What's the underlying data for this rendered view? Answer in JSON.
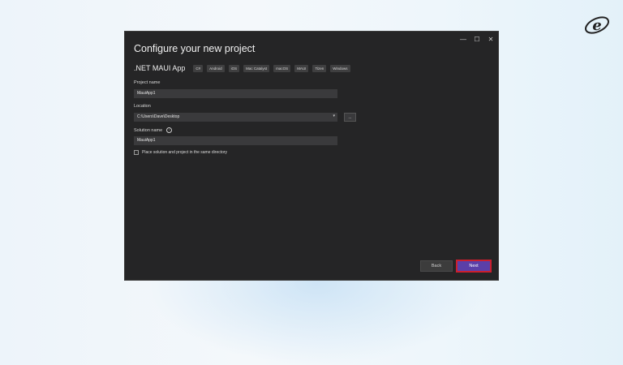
{
  "colors": {
    "accent": "#5b3fa8",
    "highlight": "#cc1f2e",
    "window_bg": "#252526"
  },
  "window": {
    "controls": {
      "minimize": "—",
      "maximize": "☐",
      "close": "✕"
    },
    "title": "Configure your new project",
    "template_name": ".NET MAUI App",
    "tags": [
      "C#",
      "Android",
      "iOS",
      "Mac Catalyst",
      "macOS",
      "MAUI",
      "Tizen",
      "Windows"
    ],
    "project_name": {
      "label": "Project name",
      "value": "MauiApp1"
    },
    "location": {
      "label": "Location",
      "value": "C:\\Users\\Dave\\Desktop",
      "browse_label": "..."
    },
    "solution_name": {
      "label": "Solution name",
      "value": "MauiApp1"
    },
    "same_directory_label": "Place solution and project in the same directory",
    "back_label": "Back",
    "next_label": "Next"
  },
  "icons": [
    "logo-icon",
    "info-icon",
    "chevron-down-icon"
  ]
}
